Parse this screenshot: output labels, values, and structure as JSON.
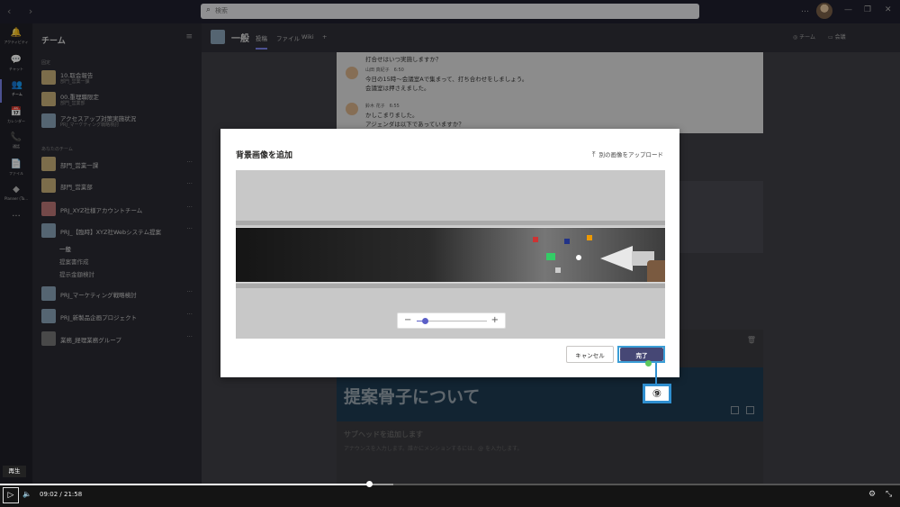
{
  "titlebar": {
    "nav": "‹ ›",
    "search_placeholder": "検索",
    "window_buttons": [
      "…",
      "—",
      "❐",
      "✕"
    ]
  },
  "rail": [
    {
      "icon": "🔔",
      "label": "アクティビティ"
    },
    {
      "icon": "💬",
      "label": "チャット"
    },
    {
      "icon": "👥",
      "label": "チーム"
    },
    {
      "icon": "📅",
      "label": "カレンダー"
    },
    {
      "icon": "📞",
      "label": "通話"
    },
    {
      "icon": "📄",
      "label": "ファイル"
    },
    {
      "icon": "◆",
      "label": "Planner (Ta..."
    },
    {
      "icon": "···",
      "label": ""
    }
  ],
  "teams_panel": {
    "title": "チーム",
    "pinned_label": "固定",
    "yours_label": "あなたのチーム",
    "pinned": [
      {
        "name": "10.取会報告",
        "sub": "部門_営業一課"
      },
      {
        "name": "00.重理職限定",
        "sub": "部門_営業部"
      },
      {
        "name": "アクセスアップ対策実施状況",
        "sub": "PRJ_マーケティング戦略検討"
      }
    ],
    "teams": [
      {
        "name": "部門_営業一課"
      },
      {
        "name": "部門_営業部"
      },
      {
        "name": "PRJ_XYZ社様アカウントチーム"
      },
      {
        "name": "PRJ_【臨時】XYZ社Webシステム提案"
      },
      {
        "name": "PRJ_マーケティング戦略検討"
      },
      {
        "name": "PRJ_新製品企画プロジェクト"
      },
      {
        "name": "業務_経理業務グループ"
      }
    ],
    "channels": [
      "一般",
      "提案書作成",
      "提示金額検討"
    ]
  },
  "channel": {
    "name": "一般",
    "tabs": [
      "投稿",
      "ファイル",
      "Wiki",
      "+"
    ],
    "team_btn": "◎ チーム",
    "meet_btn": "▭ 会議"
  },
  "messages": {
    "m0": "打合せはいつ実施しますか？",
    "m1_who": "山田 真紀子　6:50",
    "m1_l1": "今日の15時～会議室Aで集まって、打ち合わせをしましょう。",
    "m1_l2": "会議室は押さえました。",
    "m2_who": "鈴木 花子　6:55",
    "m2_l1": "かしこまりました。",
    "m2_l2": "アジェンダは以下であっていますか？"
  },
  "post": {
    "banner_title": "提案骨子について",
    "subhead": "サブヘッドを追加します",
    "hint": "アナウンスを入力します。誰かにメンションするには、@ を入力します。"
  },
  "dialog": {
    "title": "背景画像を追加",
    "upload_label": "別の画像をアップロード",
    "cancel_label": "キャンセル",
    "done_label": "完了",
    "zoom_minus": "−",
    "zoom_plus": "+",
    "zoom_level": 0.12
  },
  "callout": {
    "label": "⑨"
  },
  "video": {
    "tooltip": "再生",
    "current_time": "09:02",
    "separator": "/",
    "total_time": "21:58",
    "progress": 0.41,
    "buffered": 0.437
  },
  "colors": {
    "accent": "#464775",
    "highlight": "#2f8fd0"
  }
}
